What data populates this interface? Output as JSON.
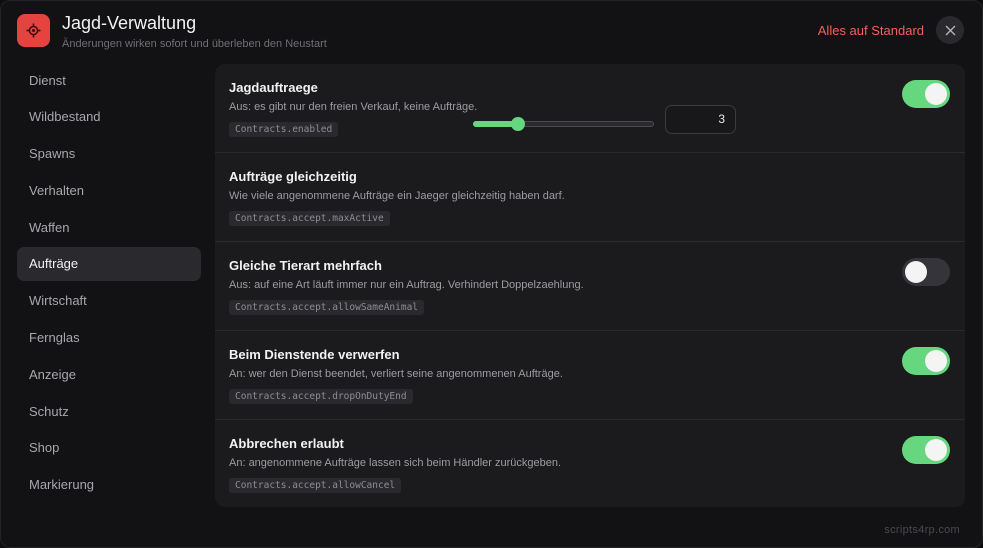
{
  "header": {
    "title": "Jagd-Verwaltung",
    "subtitle": "Änderungen wirken sofort und überleben den Neustart",
    "reset_label": "Alles auf Standard",
    "app_icon": "gear-icon",
    "close_icon": "close-icon"
  },
  "sidebar": {
    "items": [
      {
        "label": "Dienst"
      },
      {
        "label": "Wildbestand"
      },
      {
        "label": "Spawns"
      },
      {
        "label": "Verhalten"
      },
      {
        "label": "Waffen"
      },
      {
        "label": "Aufträge"
      },
      {
        "label": "Wirtschaft"
      },
      {
        "label": "Fernglas"
      },
      {
        "label": "Anzeige"
      },
      {
        "label": "Schutz"
      },
      {
        "label": "Shop"
      },
      {
        "label": "Markierung"
      }
    ],
    "active_index": 5
  },
  "settings": [
    {
      "title": "Jagdauftraege",
      "desc": "Aus: es gibt nur den freien Verkauf, keine Aufträge.",
      "key": "Contracts.enabled",
      "control": "toggle",
      "value": true
    },
    {
      "title": "Aufträge gleichzeitig",
      "desc": "Wie viele angenommene Aufträge ein Jaeger gleichzeitig haben darf.",
      "key": "Contracts.accept.maxActive",
      "control": "slider",
      "value": "3",
      "slider_fraction": 0.25
    },
    {
      "title": "Gleiche Tierart mehrfach",
      "desc": "Aus: auf eine Art läuft immer nur ein Auftrag. Verhindert Doppelzaehlung.",
      "key": "Contracts.accept.allowSameAnimal",
      "control": "toggle",
      "value": false
    },
    {
      "title": "Beim Dienstende verwerfen",
      "desc": "An: wer den Dienst beendet, verliert seine angenommenen Aufträge.",
      "key": "Contracts.accept.dropOnDutyEnd",
      "control": "toggle",
      "value": true
    },
    {
      "title": "Abbrechen erlaubt",
      "desc": "An: angenommene Aufträge lassen sich beim Händler zurückgeben.",
      "key": "Contracts.accept.allowCancel",
      "control": "toggle",
      "value": true
    }
  ],
  "footer": {
    "watermark": "scripts4rp.com"
  },
  "colors": {
    "accent": "#67d77f",
    "danger": "#f0635c",
    "app_icon_bg": "#e5433f"
  }
}
